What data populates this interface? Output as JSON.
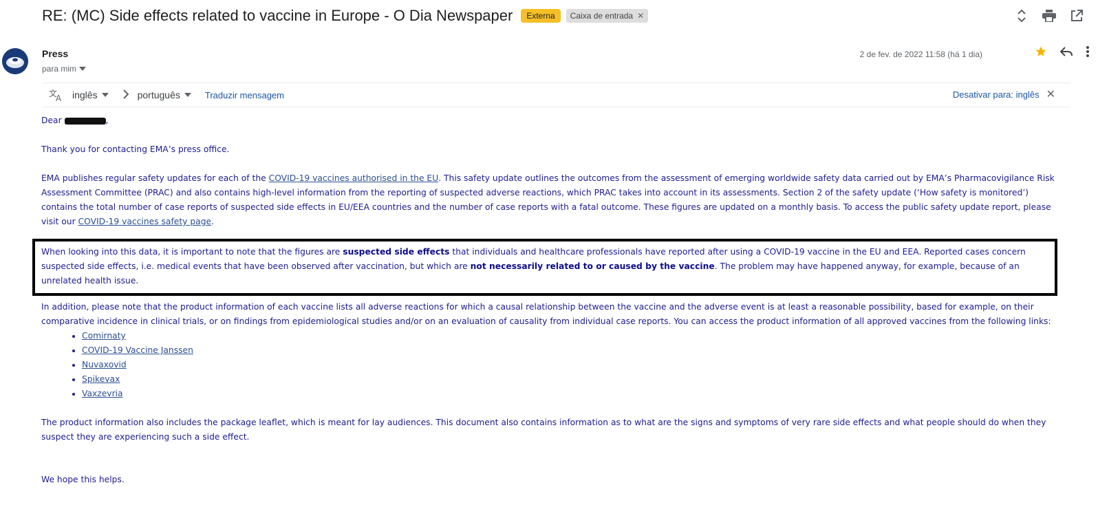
{
  "header": {
    "subject": "RE: (MC) Side effects related to vaccine in Europe - O Dia Newspaper",
    "label_external": "Externa",
    "label_inbox": "Caixa de entrada"
  },
  "sender": {
    "name": "Press",
    "to": "para mim",
    "date": "2 de fev. de 2022 11:58 (há 1 dia)"
  },
  "translate": {
    "from": "inglês",
    "to": "português",
    "action": "Traduzir mensagem",
    "disable": "Desativar para: inglês"
  },
  "body": {
    "greeting_prefix": "Dear ",
    "greeting_suffix": ",",
    "p1": "Thank you for contacting EMA’s press office.",
    "p2_a": "EMA publishes regular safety updates for each of the ",
    "p2_link1": "COVID-19 vaccines authorised in the EU",
    "p2_b": ". This safety update outlines the outcomes from the assessment of emerging worldwide safety data carried out by EMA’s Pharmacovigilance Risk Assessment Committee (PRAC) and also contains high-level information from the reporting of suspected adverse reactions, which PRAC takes into account in its assessments. Section 2 of the safety update (‘How safety is monitored’) contains the total number of case reports of suspected side effects in EU/EEA countries and the number of case reports with a fatal outcome. These figures are updated on a monthly basis. To access the public safety update report, please visit our ",
    "p2_link2": "COVID-19 vaccines safety page",
    "p2_c": ".",
    "p3_a": "When looking into this data, it is important to note that the figures are ",
    "p3_bold1": "suspected side effects",
    "p3_b": " that individuals and healthcare professionals have reported after using a COVID-19 vaccine in the EU and EEA. Reported cases concern suspected side effects, i.e. medical events that have been observed after vaccination, but which are ",
    "p3_bold2": "not necessarily related to or caused by the vaccine",
    "p3_c": ".  The problem may have happened anyway, for example, because of an unrelated health issue.",
    "p4": "In addition, please note that the product information of each vaccine lists all adverse reactions for which a causal relationship between the vaccine and the adverse event is at least a reasonable possibility, based for example, on their comparative incidence in clinical trials, or on findings from epidemiological studies and/or on an evaluation of causality from individual case reports. You can access the product information of all approved vaccines from the following links:",
    "links": [
      "Comirnaty",
      "COVID-19 Vaccine Janssen",
      "Nuvaxovid",
      "Spikevax",
      "Vaxzevria"
    ],
    "p5": "The product information also includes the package leaflet, which is meant for lay audiences. This document also contains information as to what are the signs and symptoms of very rare side effects and what people should do when they suspect they are experiencing such a side effect.",
    "p6": "We hope this helps."
  },
  "colors": {
    "body_text": "#1c1c8e",
    "link": "#2b4f93",
    "label_external_bg": "#f6bf26",
    "star": "#f4b400"
  },
  "icons": [
    "expand-collapse-icon",
    "print-icon",
    "open-new-window-icon",
    "star-icon",
    "reply-icon",
    "more-vert-icon",
    "translate-icon",
    "chevron-right-icon",
    "close-icon"
  ]
}
